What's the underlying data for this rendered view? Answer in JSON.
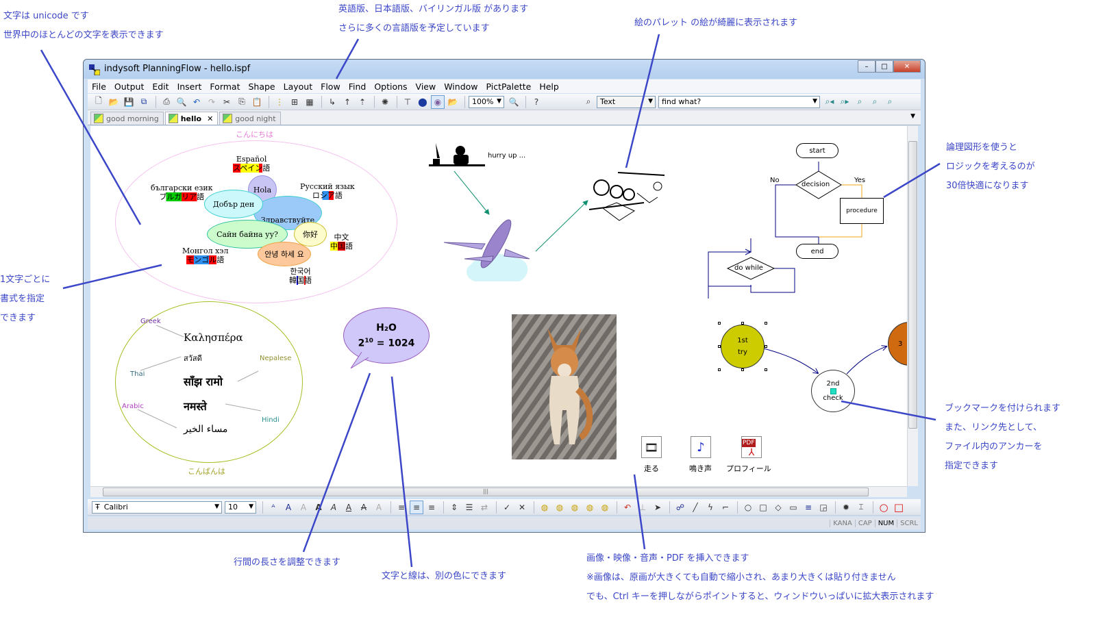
{
  "annotations": {
    "top_left": [
      "文字は unicode です",
      "世界中のほとんどの文字を表示できます"
    ],
    "top_center": [
      "英語版、日本語版、バイリンガル版 があります",
      "さらに多くの言語版を予定しています"
    ],
    "top_right": [
      "絵のパレット の絵が綺麗に表示されます"
    ],
    "right_logic": [
      "論理図形を使うと",
      "ロジックを考えるのが",
      "30倍快適になります"
    ],
    "left_format": [
      "1文字ごとに",
      "書式を指定",
      "できます"
    ],
    "right_bookmark": [
      "ブックマークを付けられます",
      "また、リンク先として、",
      "ファイル内のアンカーを",
      "指定できます"
    ],
    "bottom_linespacing": "行間の長さを調整できます",
    "bottom_color": "文字と線は、別の色にできます",
    "bottom_media": [
      "画像・映像・音声・PDF を挿入できます",
      "※画像は、原画が大きくても自動で縮小され、あまり大きくは貼り付きません",
      "でも、Ctrl キーを押しながらポイントすると、ウィンドウいっぱいに拡大表示されます"
    ]
  },
  "window": {
    "title": "indysoft PlanningFlow - hello.ispf",
    "minimize": "–",
    "maximize": "□",
    "close": "✕"
  },
  "menu": [
    "File",
    "Output",
    "Edit",
    "Insert",
    "Format",
    "Shape",
    "Layout",
    "Flow",
    "Find",
    "Options",
    "View",
    "Window",
    "PictPalette",
    "Help"
  ],
  "toolbar": {
    "zoom_value": "100%",
    "search_type": "Text",
    "search_placeholder": "find what?"
  },
  "tabs": [
    {
      "label": "good morning",
      "active": false
    },
    {
      "label": "hello",
      "active": true,
      "close": "✕"
    },
    {
      "label": "good night",
      "active": false
    }
  ],
  "canvas": {
    "hello_group": {
      "title": "こんにちは",
      "bubbles": [
        "Hola",
        "Добър ден",
        "Здравствуйте",
        "Сайн байна уу?",
        "你好",
        "안녕 하세 요"
      ],
      "labels": [
        {
          "native": "Español",
          "jp": "スペイン語"
        },
        {
          "native": "български език",
          "jp": "ブルガリア語"
        },
        {
          "native": "Русский язык",
          "jp": "ロシア語"
        },
        {
          "native": "中文",
          "jp": "中国語"
        },
        {
          "native": "Монгол хэл",
          "jp": "モンゴル語"
        },
        {
          "native": "한국어",
          "jp": "韓国語"
        }
      ]
    },
    "evening_group": {
      "title": "こんばんは",
      "phrases": [
        "Καλησπέρα",
        "สวัสดี",
        "साँझ रामो",
        "नमस्ते",
        "مساء الخير"
      ],
      "languages": [
        "Greek",
        "Thai",
        "Nepalese",
        "Arabic",
        "Hindi"
      ]
    },
    "hurry_text": "hurry up ...",
    "balloon": {
      "line1": "H₂O",
      "line2_base": "2",
      "line2_exp": "10",
      "line2_rest": " = 1024"
    },
    "flowchart": {
      "start": "start",
      "decision": "decision",
      "procedure": "procedure",
      "end": "end",
      "no": "No",
      "yes": "Yes",
      "loop": "do while"
    },
    "nodes": [
      {
        "l1": "1st",
        "l2": "try"
      },
      {
        "l1": "2nd",
        "l2": "check"
      },
      {
        "l1": "3"
      }
    ],
    "media": [
      {
        "icon": "film",
        "label": "走る"
      },
      {
        "icon": "music",
        "label": "鳴き声"
      },
      {
        "icon": "pdf",
        "label": "プロフィール"
      }
    ]
  },
  "format_toolbar": {
    "font": "Calibri",
    "size": "10"
  },
  "status": [
    "KANA",
    "CAP",
    "NUM",
    "SCRL"
  ],
  "colors": {
    "annotation": "#3b46c8",
    "title_bar": "#c7dcf5",
    "flow_line": "#000080",
    "yes_line": "#f0a020",
    "node1": "#cccc00",
    "node3": "#d06a10"
  }
}
